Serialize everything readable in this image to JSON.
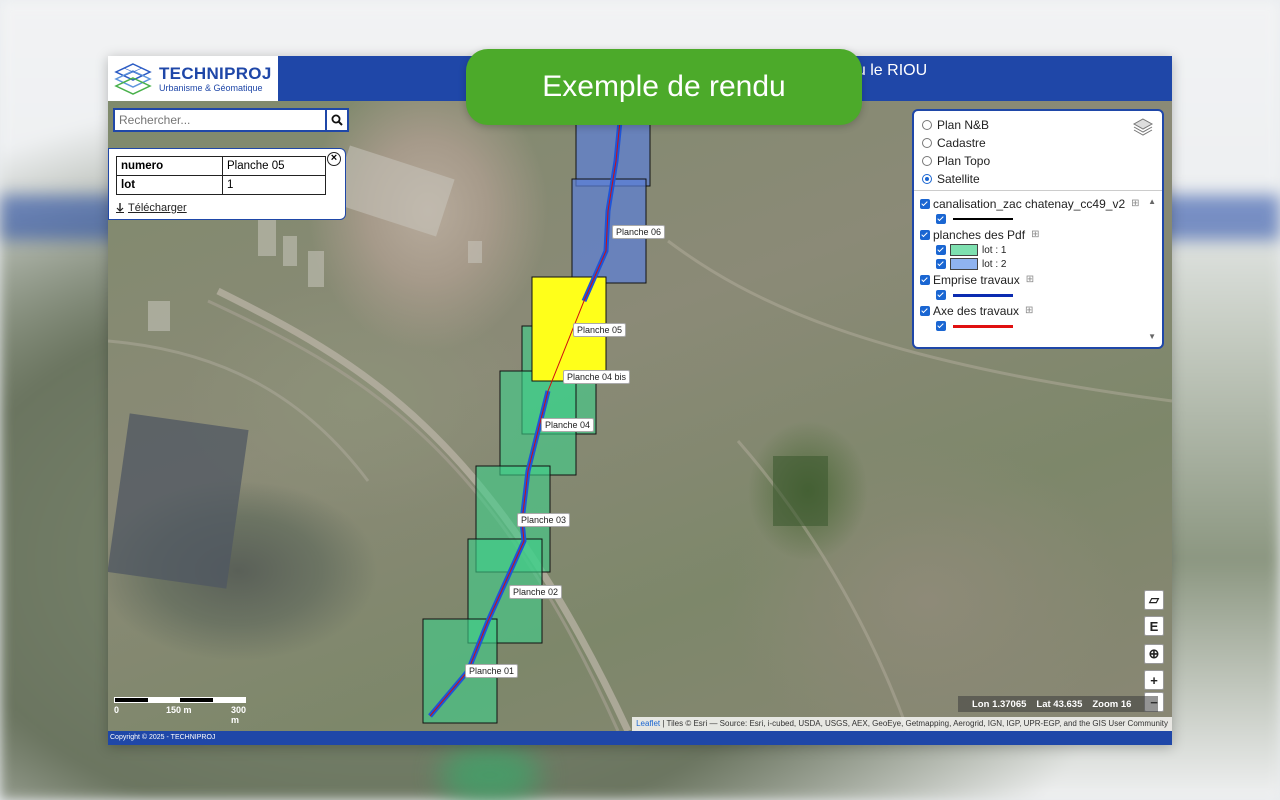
{
  "header": {
    "logo_title": "TECHNIPROJ",
    "logo_subtitle": "Urbanisme & Géomatique",
    "title": "au le RIOU"
  },
  "banner": {
    "text": "Exemple de rendu"
  },
  "search": {
    "placeholder": "Rechercher..."
  },
  "info_panel": {
    "rows": [
      {
        "key": "numero",
        "value": "Planche 05"
      },
      {
        "key": "lot",
        "value": "1"
      }
    ],
    "download_label": "Télécharger"
  },
  "layer_control": {
    "base_layers": [
      {
        "label": "Plan N&B",
        "selected": false
      },
      {
        "label": "Cadastre",
        "selected": false
      },
      {
        "label": "Plan Topo",
        "selected": false
      },
      {
        "label": "Satellite",
        "selected": true
      }
    ],
    "overlays": [
      {
        "label": "canalisation_zac chatenay_cc49_v2",
        "checked": true,
        "legend_color": "#000000"
      },
      {
        "label": "planches des Pdf",
        "checked": true,
        "sub": [
          {
            "label": "lot : 1",
            "color": "#7ee0b0"
          },
          {
            "label": "lot : 2",
            "color": "#8fb3f0"
          }
        ]
      },
      {
        "label": "Emprise travaux",
        "checked": true,
        "legend_color": "#0b2bb0"
      },
      {
        "label": "Axe des travaux",
        "checked": true,
        "legend_color": "#e01010"
      }
    ]
  },
  "planches": [
    {
      "label": "Planche 06",
      "lot": 2
    },
    {
      "label": "Planche 05",
      "lot": 1,
      "selected": true
    },
    {
      "label": "Planche 04 bis",
      "lot": 1
    },
    {
      "label": "Planche 04",
      "lot": 1
    },
    {
      "label": "Planche 03",
      "lot": 1
    },
    {
      "label": "Planche 02",
      "lot": 1
    },
    {
      "label": "Planche 01",
      "lot": 1
    }
  ],
  "controls": {
    "measure": "▱",
    "edit": "E",
    "locate": "⊕",
    "zoom_in": "+",
    "zoom_out": "−"
  },
  "status": {
    "lon_label": "Lon",
    "lon": "1.37065",
    "lat_label": "Lat",
    "lat": "43.635",
    "zoom_label": "Zoom",
    "zoom": "16"
  },
  "scale": {
    "t0": "0",
    "t1": "150 m",
    "t2": "300 m"
  },
  "attribution": {
    "leaflet": "Leaflet",
    "text": " | Tiles © Esri — Source: Esri, i-cubed, USDA, USGS, AEX, GeoEye, Getmapping, Aerogrid, IGN, IGP, UPR-EGP, and the GIS User Community"
  },
  "footer": {
    "copyright": "Copyright © 2025 - TECHNIPROJ"
  }
}
